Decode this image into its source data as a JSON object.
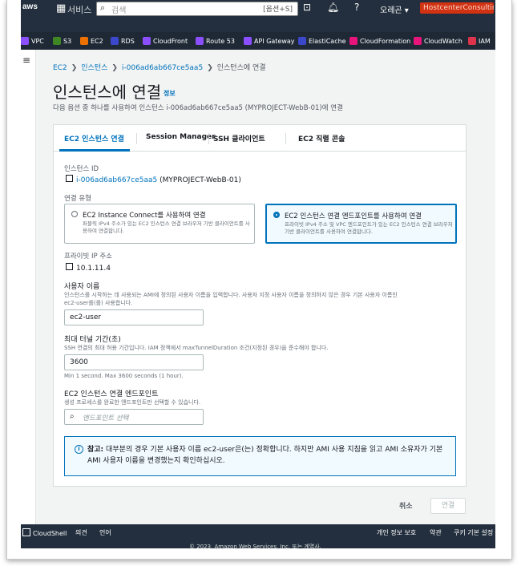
{
  "topbar": {
    "services_label": "서비스",
    "search_placeholder": "검색",
    "search_shortcut": "[옵션+S]",
    "region": "오레곤 ▾",
    "account": "HostcenterConsulting ▾"
  },
  "services": [
    {
      "label": "VPC",
      "color": "#8c4fff"
    },
    {
      "label": "S3",
      "color": "#3f8624"
    },
    {
      "label": "EC2",
      "color": "#ed7100"
    },
    {
      "label": "RDS",
      "color": "#3b48cc"
    },
    {
      "label": "CloudFront",
      "color": "#8c4fff"
    },
    {
      "label": "Route 53",
      "color": "#8c4fff"
    },
    {
      "label": "API Gateway",
      "color": "#8c4fff"
    },
    {
      "label": "ElastiCache",
      "color": "#3b48cc"
    },
    {
      "label": "CloudFormation",
      "color": "#e7157b"
    },
    {
      "label": "CloudWatch",
      "color": "#e7157b"
    },
    {
      "label": "IAM",
      "color": "#dd344c"
    }
  ],
  "breadcrumb": {
    "items": [
      "EC2",
      "인스턴스",
      "i-006ad6ab667ce5aa5"
    ],
    "current": "인스턴스에 연결"
  },
  "page": {
    "title": "인스턴스에 연결",
    "info_link": "정보",
    "subtitle": "다음 옵션 중 하나를 사용하여 인스턴스 i-006ad6ab667ce5aa5 (MYPROJECT-WebB-01)에 연결"
  },
  "tabs": [
    "EC2 인스턴스 연결",
    "Session Manager",
    "SSH 클라이언트",
    "EC2 직렬 콘솔"
  ],
  "form": {
    "instance_id_label": "인스턴스 ID",
    "instance_id_link": "i-006ad6ab667ce5aa5",
    "instance_id_name": "(MYPROJECT-WebB-01)",
    "conn_type_label": "연결 유형",
    "option1_title": "EC2 Instance Connect를 사용하여 연결",
    "option1_desc": "퍼블릭 IPv4 주소가 있는 EC2 인스턴스 연결 브라우저 기반 클라이언트를 사용하여 연결합니다.",
    "option2_title": "EC2 인스턴스 연결 엔드포인트를 사용하여 연결",
    "option2_desc": "프라이빗 IPv4 주소 및 VPC 엔드포인트가 있는 EC2 인스턴스 연결 브라우저 기반 클라이언트를 사용하여 연결합니다.",
    "private_ip_label": "프라이빗 IP 주소",
    "private_ip": "10.1.11.4",
    "username_label": "사용자 이름",
    "username_desc_1": "인스턴스를 시작하는 데 사용되는 AMI에 정의된 사용자 이름을 입력합니다. 사용자 지정 사용자 이름을 정의하지 않은 경우 기본 사용자 이름인",
    "username_desc_2": "ec2-user를(를) 사용합니다.",
    "username_value": "ec2-user",
    "tunnel_label": "최대 터널 기간(초)",
    "tunnel_desc": "SSH 연결의 최대 허용 기간입니다. IAM 정책에서 maxTunnelDuration 조건(지정된 경우)을 준수해야 합니다.",
    "tunnel_value": "3600",
    "tunnel_hint": "Min 1 second. Max 3600 seconds (1 hour).",
    "endpoint_label": "EC2 인스턴스 연결 엔드포인트",
    "endpoint_desc": "생성 프로세스를 완료한 엔드포인트만 선택할 수 있습니다.",
    "endpoint_placeholder": "엔드포인트 선택"
  },
  "alert": {
    "bold": "참고:",
    "text": " 대부분의 경우 기본 사용자 이름 ec2-user은(는) 정확합니다. 하지만 AMI 사용 지침을 읽고 AMI 소유자가 기본 AMI 사용자 이름을 변경했는지 확인하십시오."
  },
  "actions": {
    "cancel": "취소",
    "connect": "연결"
  },
  "footer": {
    "cloudshell": "CloudShell",
    "feedback": "의견",
    "language": "언어",
    "privacy": "개인 정보 보호",
    "terms": "약관",
    "cookies": "쿠키 기본 설정",
    "copyright": "© 2023, Amazon Web Services, Inc. 또는 계열사."
  }
}
